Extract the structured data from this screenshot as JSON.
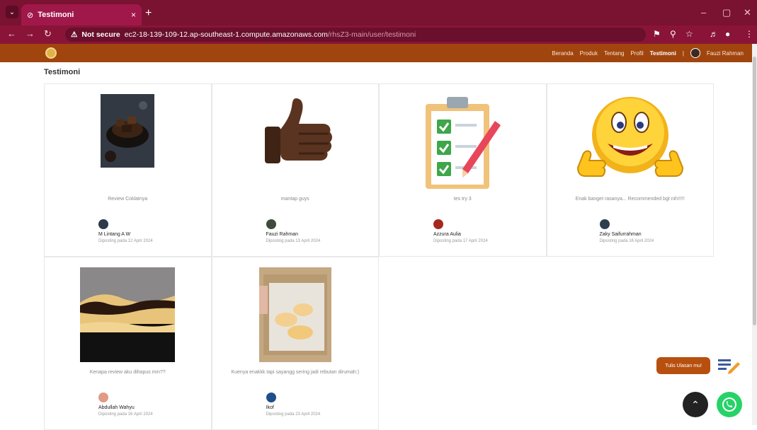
{
  "browser": {
    "tab_title": "Testimoni",
    "tab_close": "×",
    "new_tab": "+",
    "security": "Not secure",
    "url_host": "ec2-18-139-109-12.ap-southeast-1.compute.amazonaws.com",
    "url_path": "/rhsZ3-main/user/testimoni",
    "window_controls": [
      "–",
      "▢",
      "✕"
    ]
  },
  "nav": {
    "links": [
      "Beranda",
      "Produk",
      "Tentang",
      "Profil",
      "Testimoni"
    ],
    "active": "Testimoni",
    "separator": "|",
    "user_name": "Fauzi Rahman"
  },
  "page": {
    "title": "Testimoni"
  },
  "testimonials": [
    {
      "caption": "Review Coklatnya",
      "name": "M Lintang A W",
      "date": "Diposting pada 12 April 2024",
      "image": "chocolate-dessert",
      "avatar_color": "#2b3a4a"
    },
    {
      "caption": "mantap guys",
      "name": "Fauzi Rahman",
      "date": "Diposting pada 13 April 2024",
      "image": "thumbs-up",
      "avatar_color": "#3e4a3a"
    },
    {
      "caption": "tes try 3",
      "name": "Azzura Aulia",
      "date": "Diposting pada 17 April 2024",
      "image": "checklist-clipboard",
      "avatar_color": "#a4281e"
    },
    {
      "caption": "Enak banget rasanya... Recommended bgt nih!!!!!",
      "name": "Zaky Saifurrahman",
      "date": "Diposting pada 16 April 2024",
      "image": "smiley-thumbs",
      "avatar_color": "#2c3e50"
    },
    {
      "caption": "Kenapa review aku dihapus min??",
      "name": "Abdullah Wahyu",
      "date": "Diposting pada 16 April 2024",
      "image": "burnt-cheesecake",
      "avatar_color": "#e29a86"
    },
    {
      "caption": "Kuenya enakkk tapi sayangg sering jadi rebutan dirumah:)",
      "name": "Ikof",
      "date": "Diposting pada 23 April 2024",
      "image": "cake-box",
      "avatar_color": "#1f4f8a"
    }
  ],
  "floating": {
    "testimoni_button": "Tulis Ulasan mu!",
    "scroll_top": "⌃",
    "whatsapp": "whatsapp-icon"
  }
}
